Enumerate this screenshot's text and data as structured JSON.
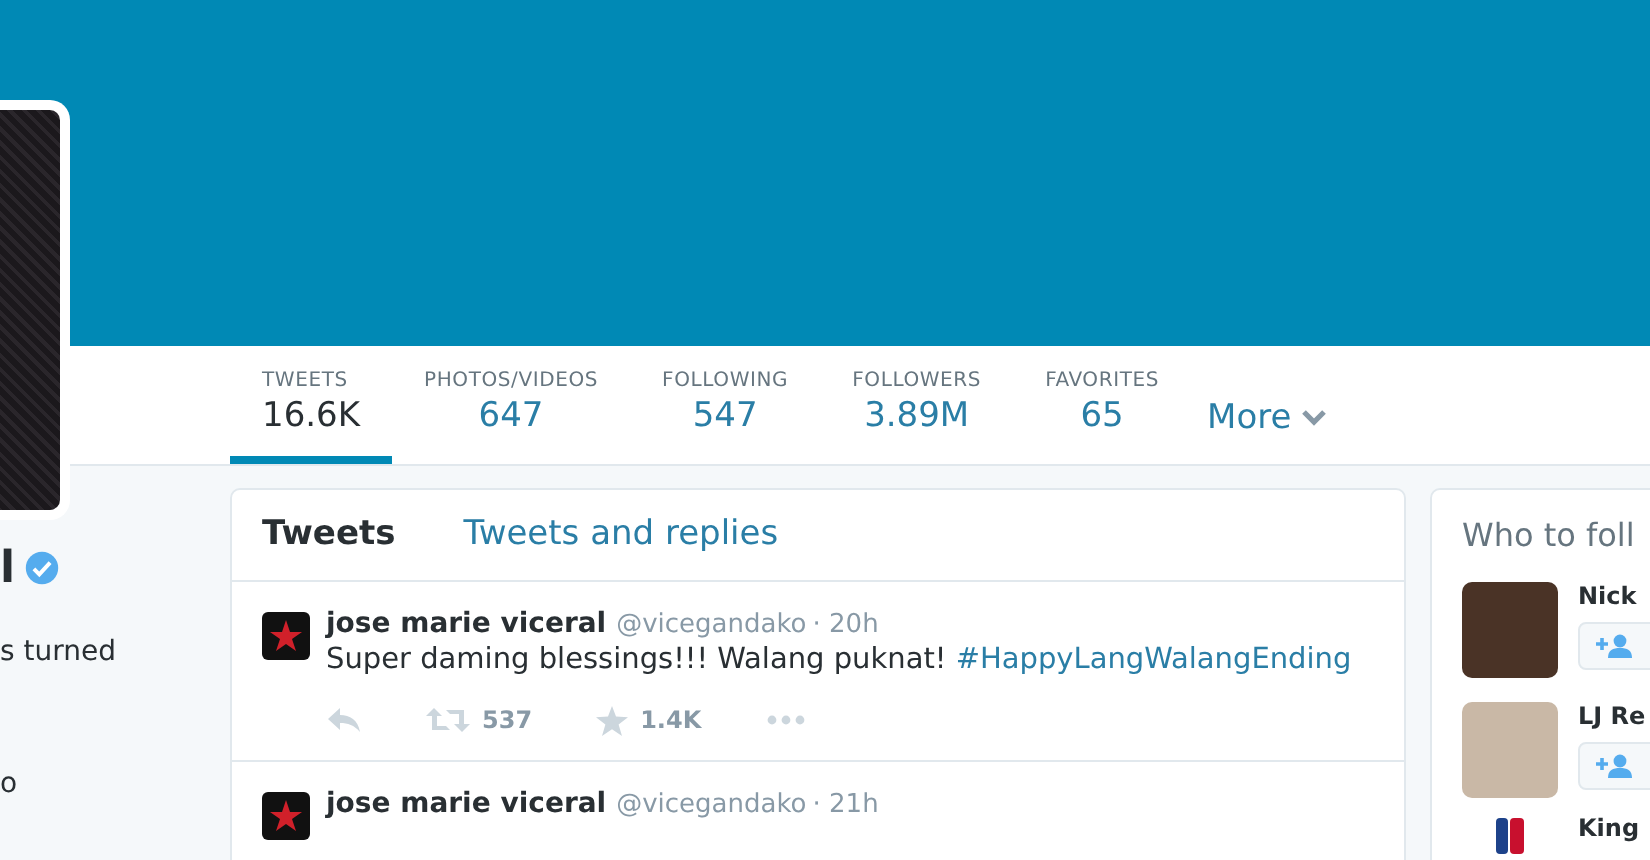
{
  "profile": {
    "name": "l",
    "verified": true,
    "bio_fragments": [
      "s turned",
      "o"
    ]
  },
  "stats": [
    {
      "label": "TWEETS",
      "value": "16.6K",
      "selected": true
    },
    {
      "label": "PHOTOS/VIDEOS",
      "value": "647",
      "selected": false
    },
    {
      "label": "FOLLOWING",
      "value": "547",
      "selected": false
    },
    {
      "label": "FOLLOWERS",
      "value": "3.89M",
      "selected": false
    },
    {
      "label": "FAVORITES",
      "value": "65",
      "selected": false
    }
  ],
  "more": {
    "label": "More"
  },
  "timeline_tabs": [
    {
      "label": "Tweets",
      "selected": true
    },
    {
      "label": "Tweets and replies",
      "selected": false
    }
  ],
  "tweets": [
    {
      "name": "jose marie viceral",
      "handle": "@vicegandako",
      "time": "· 20h",
      "text": "Super daming blessings!!! Walang puknat! ",
      "hashtag": "#HappyLangWalangEnding",
      "retweets": "537",
      "favorites": "1.4K"
    },
    {
      "name": "jose marie viceral",
      "handle": "@vicegandako",
      "time": "· 21h"
    }
  ],
  "who_to_follow": {
    "title": "Who to foll",
    "people": [
      {
        "name": "Nick",
        "follow_button": true
      },
      {
        "name": "LJ Re",
        "follow_button": true
      },
      {
        "name": "King",
        "follow_button": false
      }
    ]
  }
}
